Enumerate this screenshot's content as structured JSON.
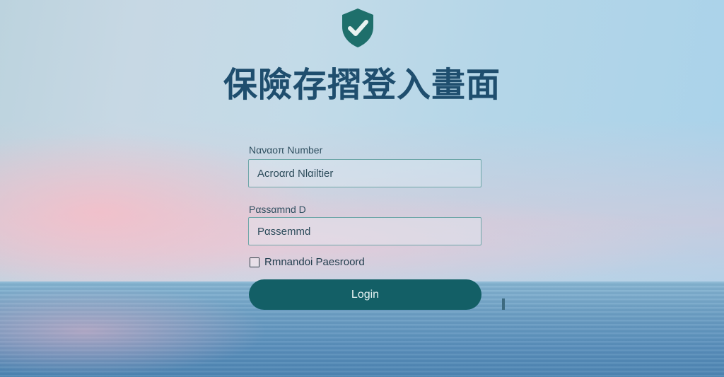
{
  "header": {
    "logo_icon": "shield-check-icon",
    "title": "保險存摺登入畫面"
  },
  "form": {
    "account": {
      "label": "Nαναοπ Number",
      "placeholder": "Acroαrd Nlαiltier"
    },
    "password": {
      "label": "Pαssαmnd D",
      "placeholder": "Pαssemmd"
    },
    "remember": {
      "label": "Rmnandoi Paesroord",
      "checked": false
    },
    "login_label": "Login"
  },
  "colors": {
    "accent": "#135f66",
    "title": "#1f4e6e",
    "field_border": "#6fa7a9"
  }
}
